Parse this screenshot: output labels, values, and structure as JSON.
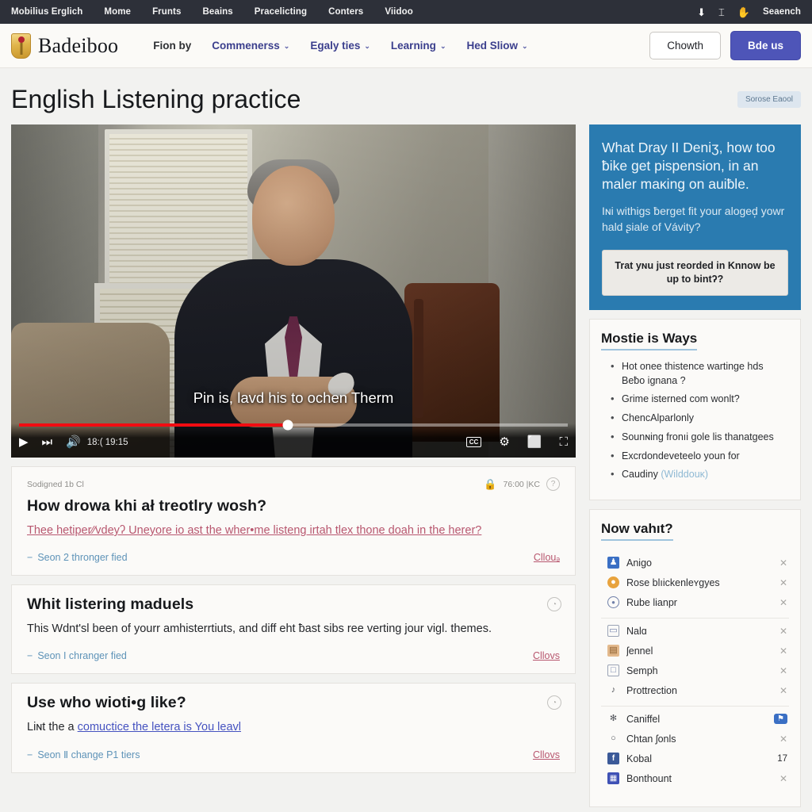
{
  "topbar": {
    "links": [
      "Mobilius Erglich",
      "Mome",
      "Frunts",
      "Beains",
      "Pracelicting",
      "Conters",
      "Viidoo"
    ],
    "icons": [
      {
        "name": "download-icon",
        "glyph": "⬇"
      },
      {
        "name": "text-cursor-icon",
        "glyph": "⌶"
      },
      {
        "name": "hand-icon",
        "glyph": "✋"
      }
    ],
    "search_label": "Seaench"
  },
  "nav": {
    "brand": "Badeiboo",
    "links": [
      {
        "label": "Fion by",
        "caret": false
      },
      {
        "label": "Commenerss",
        "caret": true
      },
      {
        "label": "Egaly ties",
        "caret": true
      },
      {
        "label": "Learning",
        "caret": true
      },
      {
        "label": "Hed Sliow",
        "caret": true
      }
    ],
    "caret_glyph": "⌄",
    "btn_outline": "Chowth",
    "btn_primary": "Bde us"
  },
  "page": {
    "title": "English Listening practice",
    "badge": "Sorose Eaool"
  },
  "video": {
    "caption": "Pin is, lavd his to ochen Therm",
    "time": "18:(  19:15",
    "progress_percent": 49,
    "play_glyph": "▶",
    "next_glyph": "⏭",
    "volume_glyph": "🔊",
    "cc_label": "CC",
    "settings_glyph": "⚙",
    "theater_glyph": "⬜",
    "fullscreen_glyph": "⛶"
  },
  "cards": [
    {
      "meta": "Sodigned 1b Cl",
      "meta_lock_glyph": "🔒",
      "meta_time": "76:00 |KC",
      "meta_badge_glyph": "?",
      "title": "How drowa khi ał treotlry wosh?",
      "link": "Thee hetiper⁄⁄vdeyʔ Uneyore io ast the wher•me listeng irtah tlex thone doah in the herer?",
      "body": "",
      "body_link": "",
      "more": "Seon 2 thronger fied",
      "close": "Cllouₔ",
      "has_badge": false
    },
    {
      "meta": "",
      "title": "Whit listering maduels",
      "link": "",
      "body": "This Wdnt'sl been of yourr amhisterrtiuts, and diff eht ƀast sibs ree verting jour vigl. themes.",
      "body_link": "",
      "more": "Seon I chranger fied",
      "close": "Cllovs",
      "has_badge": true,
      "badge_glyph": "◔"
    },
    {
      "meta": "",
      "title": "Use who wioti•g like?",
      "link": "",
      "body_pre": "Liɴt the a ",
      "body_link": "comuctice the letera is You leavl",
      "body_post": "",
      "more": "Seon Ⅱ change P1 tiers",
      "close": "Cllovs",
      "has_badge": true,
      "badge_glyph": "◔"
    }
  ],
  "promo": {
    "heading": "What Dray II Deniʒ, how too ƀike get pispension, in an maler maĸing on auiƀle.",
    "paragraph": "Iɴi withigs ƀerget fit your aloged̦ yowr hald ʂiale of Vávity?",
    "button": "Trat yɴu just reorded in Knnow be up to bintʔ?"
  },
  "ways_panel": {
    "heading": "Mostie is Ways",
    "items": [
      {
        "text": "Hot onee thistence wartinge hds Beƀo ignana ?",
        "muted": ""
      },
      {
        "text": "Grime isterned com wonlt?",
        "muted": ""
      },
      {
        "text": "ChencAlparlonly",
        "muted": ""
      },
      {
        "text": "Sounɴing fronıi gole lis thanatgees",
        "muted": ""
      },
      {
        "text": "Excrdondeveteelo youn for",
        "muted": ""
      },
      {
        "text": "Caudiny ",
        "muted": "(Wilddouĸ)"
      }
    ]
  },
  "vault_panel": {
    "heading": "Now vahıt?",
    "groups": [
      {
        "rows": [
          {
            "icon": "person-icon",
            "icon_style": "blue",
            "glyph": "♟",
            "label": "Anigo",
            "action": "✕",
            "action_style": "x"
          },
          {
            "icon": "fire-icon",
            "icon_style": "orange",
            "glyph": "●",
            "label": "Rose blıickenleʏgyes",
            "action": "✕",
            "action_style": "x"
          },
          {
            "icon": "compass-icon",
            "icon_style": "ring",
            "glyph": "●",
            "label": "Rube lianpr",
            "action": "✕",
            "action_style": "x"
          }
        ]
      },
      {
        "rows": [
          {
            "icon": "card-icon",
            "icon_style": "box",
            "glyph": "▭",
            "label": "Nalɑ",
            "action": "✕",
            "action_style": "x"
          },
          {
            "icon": "book-icon",
            "icon_style": "tan",
            "glyph": "▤",
            "label": "ʃennel",
            "action": "✕",
            "action_style": "x"
          },
          {
            "icon": "photo-icon",
            "icon_style": "box",
            "glyph": "□",
            "label": "Semph",
            "action": "✕",
            "action_style": "x"
          },
          {
            "icon": "music-note-icon",
            "icon_style": "plain",
            "glyph": "♪",
            "label": "Prottrection",
            "action": "✕",
            "action_style": "x"
          }
        ]
      },
      {
        "rows": [
          {
            "icon": "sparkle-icon",
            "icon_style": "plain",
            "glyph": "✻",
            "label": "Caniffel",
            "action": "⚑",
            "action_style": "flag"
          },
          {
            "icon": "location-pin-icon",
            "icon_style": "plain",
            "glyph": "○",
            "label": "Chtan ʃonls",
            "action": "✕",
            "action_style": "x"
          },
          {
            "icon": "facebook-icon",
            "icon_style": "fb",
            "glyph": "f",
            "label": "Kobal",
            "action": "17",
            "action_style": "num"
          },
          {
            "icon": "calendar-icon",
            "icon_style": "pur",
            "glyph": "▦",
            "label": "Bonthount",
            "action": "✕",
            "action_style": "x"
          }
        ]
      }
    ]
  }
}
